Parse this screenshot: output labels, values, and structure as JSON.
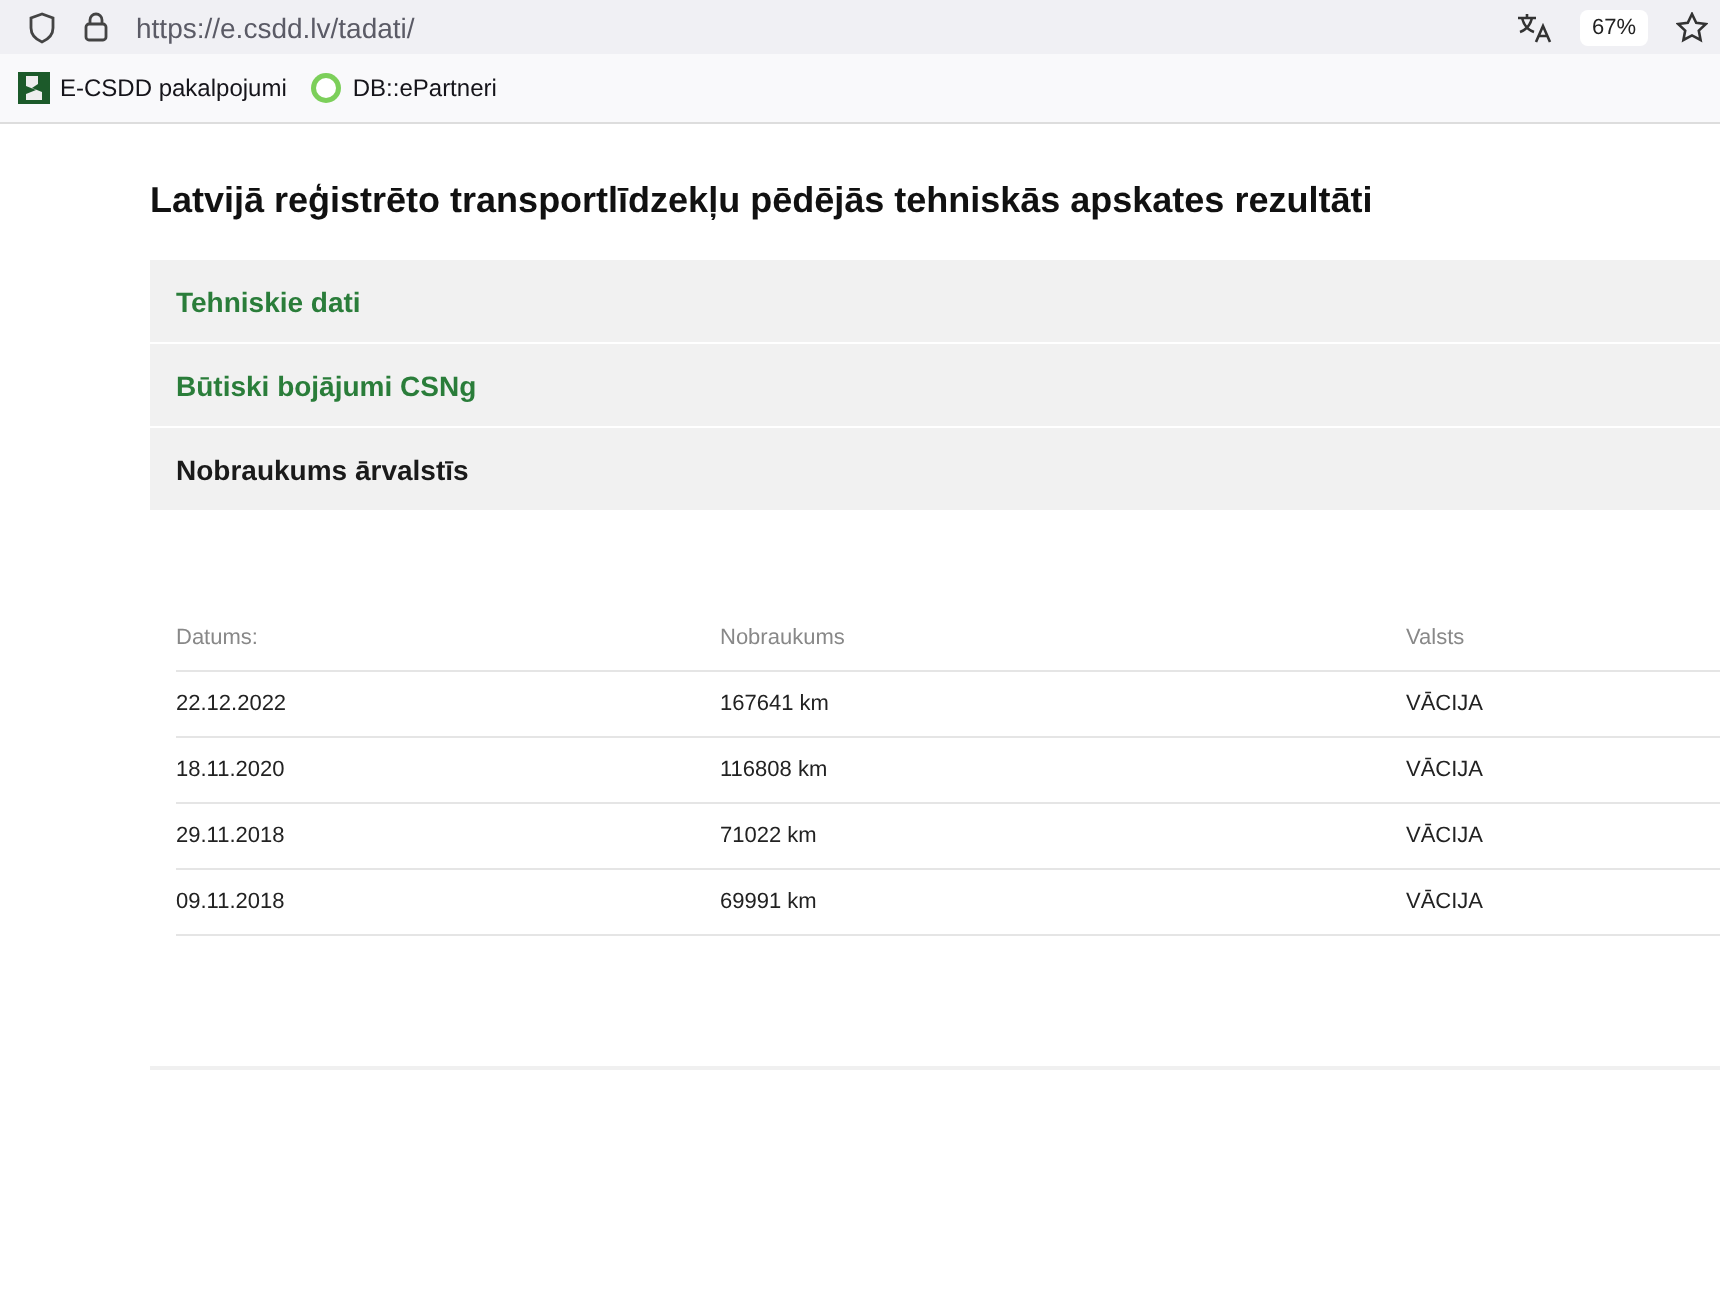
{
  "browser": {
    "url": "https://e.csdd.lv/tadati/",
    "zoom": "67%",
    "bookmarks": [
      {
        "kind": "csdd",
        "label": "E-CSDD pakalpojumi"
      },
      {
        "kind": "epartneri",
        "label": "DB::ePartneri"
      }
    ]
  },
  "page": {
    "title": "Latvijā reģistrēto transportlīdzekļu pēdējās tehniskās apskates rezultāti",
    "sections": [
      {
        "label": "Tehniskie dati",
        "expanded": false
      },
      {
        "label": "Būtiski bojājumi CSNg",
        "expanded": false
      },
      {
        "label": "Nobraukums ārvalstīs",
        "expanded": true
      }
    ],
    "table": {
      "columns": [
        "Datums:",
        "Nobraukums",
        "Valsts"
      ],
      "rows": [
        [
          "22.12.2022",
          "167641 km",
          "VĀCIJA"
        ],
        [
          "18.11.2020",
          "116808 km",
          "VĀCIJA"
        ],
        [
          "29.11.2018",
          "71022 km",
          "VĀCIJA"
        ],
        [
          "09.11.2018",
          "69991 km",
          "VĀCIJA"
        ]
      ]
    }
  }
}
